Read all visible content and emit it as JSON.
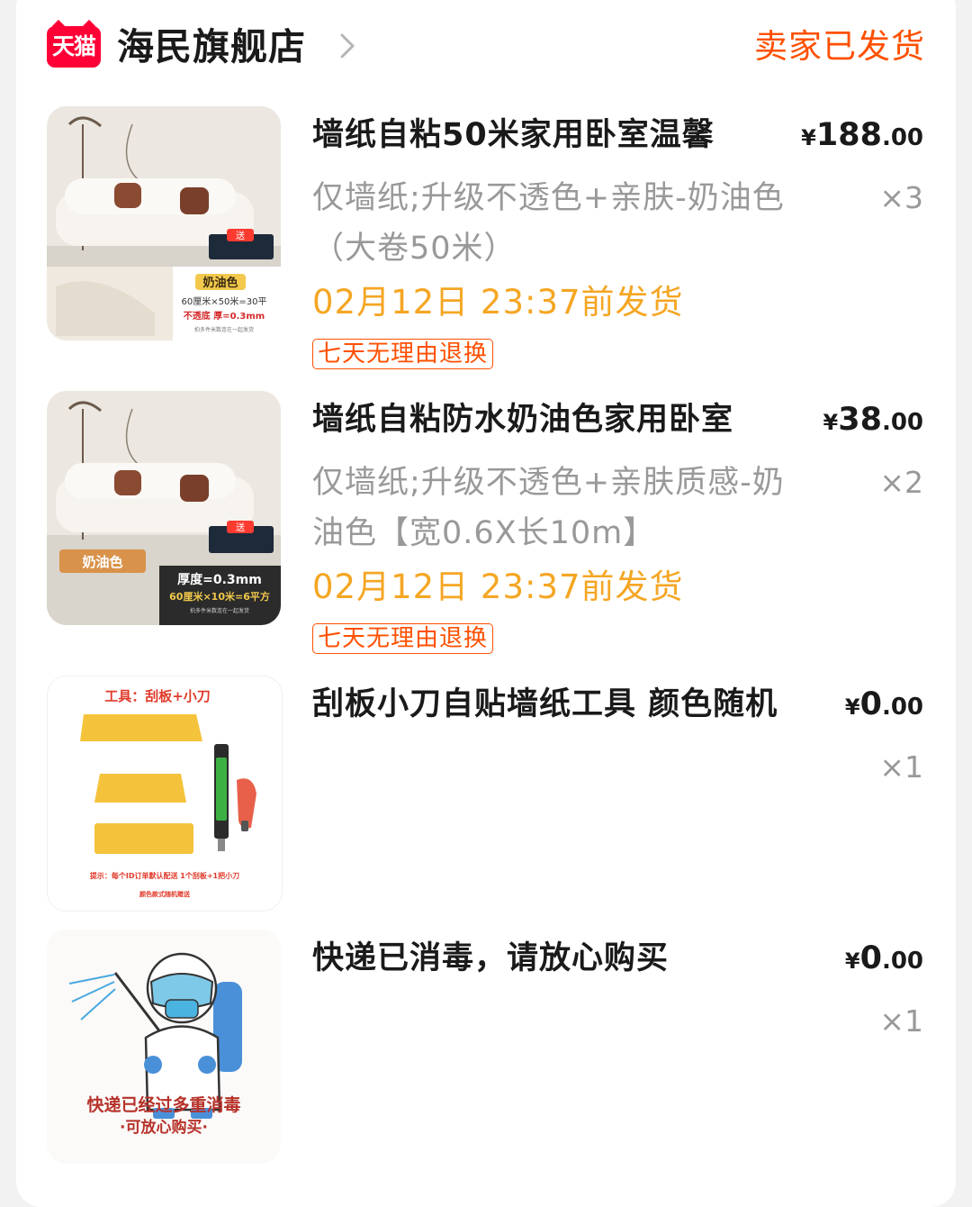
{
  "shop": {
    "logo_text": "天猫",
    "name": "海民旗舰店",
    "status": "卖家已发货"
  },
  "items": [
    {
      "title": "墙纸自粘50米家用卧室温馨",
      "price_currency": "¥",
      "price_int": "188",
      "price_dec": ".00",
      "sku": "仅墙纸;升级不透色+亲肤-奶油色（大卷50米）",
      "qty": "×3",
      "ship_time": "02月12日 23:37前发货",
      "tag": "七天无理由退换",
      "image_text": {
        "gift": "送",
        "color": "奶油色",
        "spec": "60厘米×50米=30平",
        "thickness": "不透底 厚=0.3mm",
        "note": "拍多件米数连在一起发货"
      }
    },
    {
      "title": "墙纸自粘防水奶油色家用卧室",
      "price_currency": "¥",
      "price_int": "38",
      "price_dec": ".00",
      "sku": "仅墙纸;升级不透色+亲肤质感-奶油色【宽0.6X长10m】",
      "qty": "×2",
      "ship_time": "02月12日 23:37前发货",
      "tag": "七天无理由退换",
      "image_text": {
        "gift": "送",
        "color": "奶油色",
        "thickness": "厚度=0.3mm",
        "spec": "60厘米×10米=6平方",
        "note": "拍多件米数连在一起发货"
      }
    },
    {
      "title": "刮板小刀自贴墙纸工具 颜色随机",
      "price_currency": "¥",
      "price_int": "0",
      "price_dec": ".00",
      "qty": "×1",
      "image_text": {
        "heading": "工具：刮板+小刀",
        "tip": "提示：每个ID订单默认配送 1个刮板+1把小刀",
        "note": "颜色款式随机赠送"
      }
    },
    {
      "title": "快递已消毒，请放心购买",
      "price_currency": "¥",
      "price_int": "0",
      "price_dec": ".00",
      "qty": "×1",
      "image_text": {
        "line1": "快递已经过多重消毒",
        "line2": "·可放心购买·"
      }
    }
  ],
  "colors": {
    "status_orange": "#ff5000",
    "ship_orange": "#f5a623",
    "tmall_red": "#ff0036",
    "muted_gray": "#999999"
  }
}
